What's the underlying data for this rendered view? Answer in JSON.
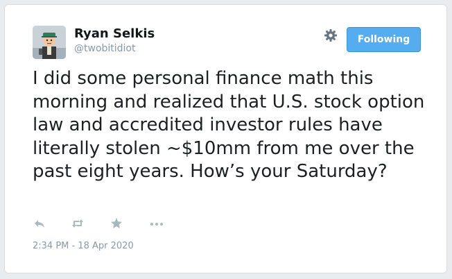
{
  "tweet": {
    "author": {
      "name": "Ryan Selkis",
      "handle": "@twobitidiot"
    },
    "follow_button_label": "Following",
    "text": "I did some personal finance math this morning and realized that U.S. stock option law and accredited investor rules have literally stolen ~$10mm from me over the past eight years. How’s your Saturday?",
    "timestamp": "2:34 PM - 18 Apr 2020",
    "actions": [
      "reply-icon",
      "retweet-icon",
      "like-icon",
      "more-icon"
    ]
  },
  "colors": {
    "follow_button": "#55acee",
    "secondary_text": "#8899a6",
    "primary_text": "#14171a"
  }
}
